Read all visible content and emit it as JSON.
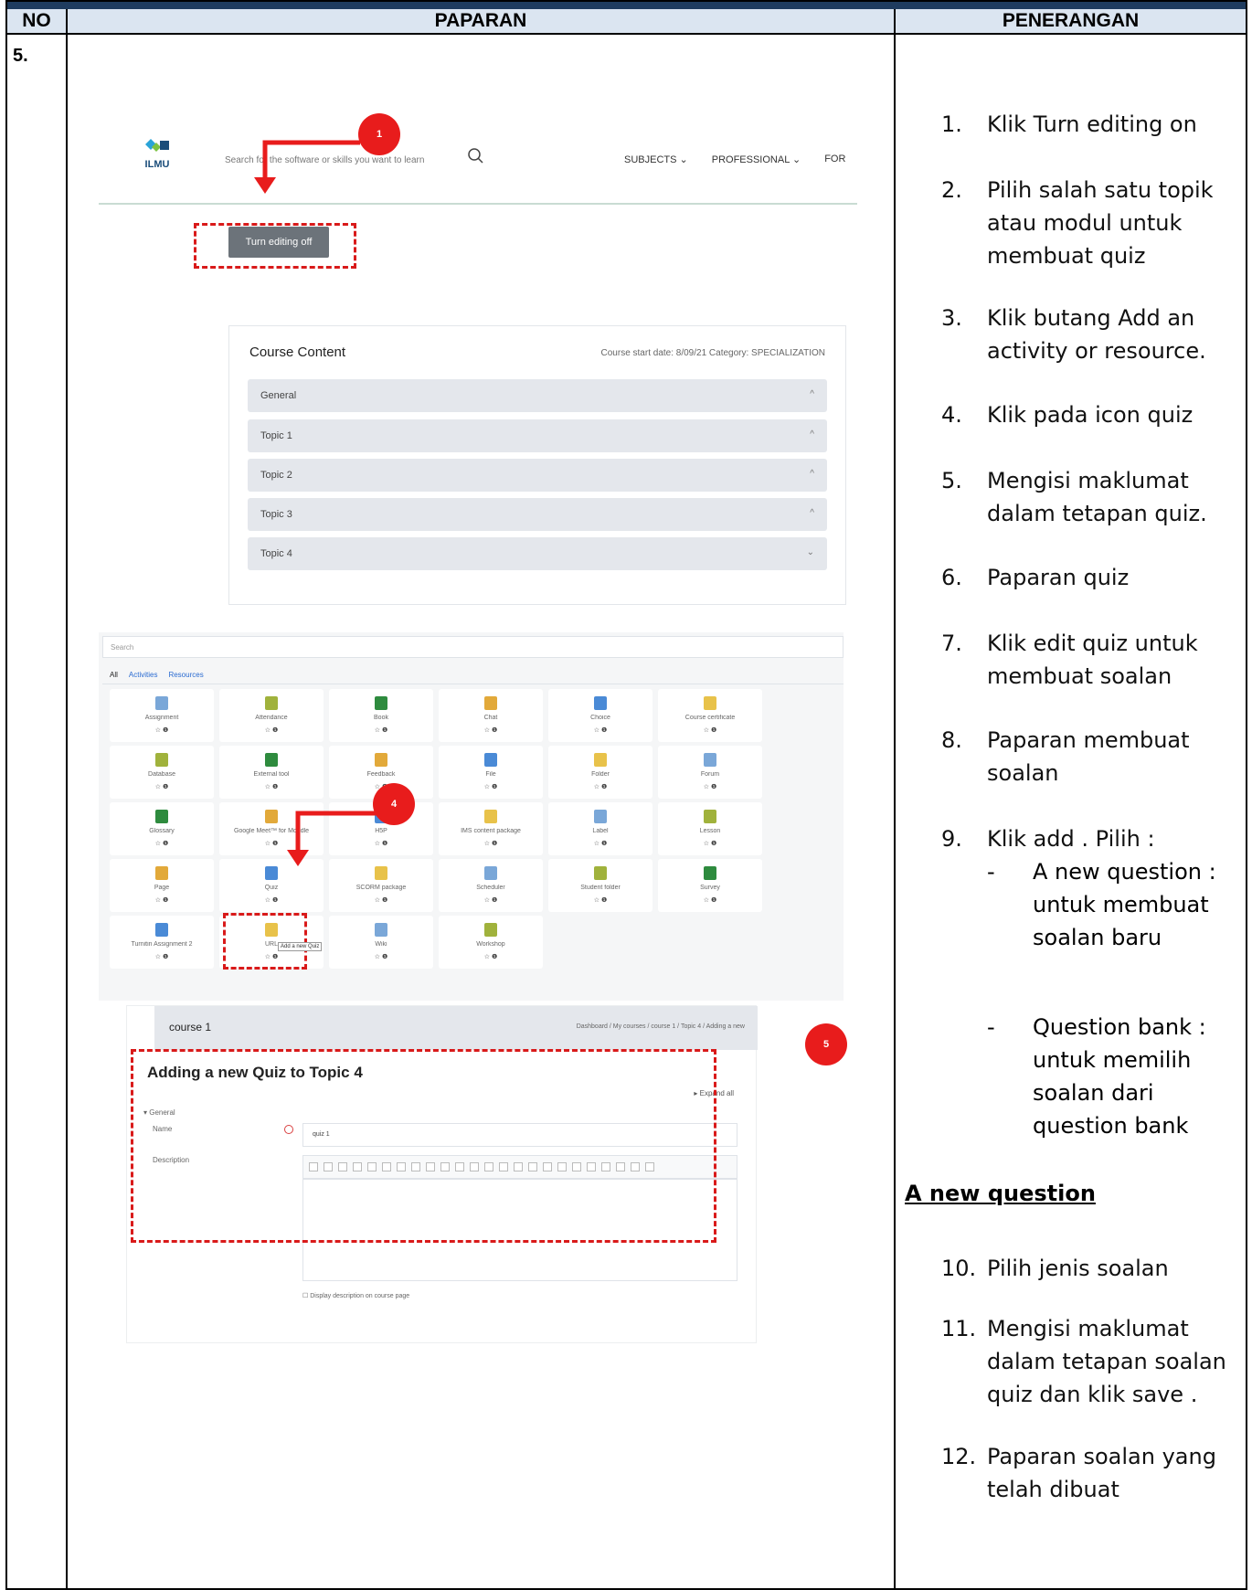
{
  "header": {
    "col_no": "NO",
    "col_display": "PAPARAN",
    "col_desc": "PENERANGAN"
  },
  "row": {
    "number": "5."
  },
  "steps": [
    {
      "n": "1.",
      "text": "Klik Turn editing on"
    },
    {
      "n": "2.",
      "text": "Pilih salah satu topik atau modul untuk membuat quiz"
    },
    {
      "n": "3.",
      "text": "Klik butang Add an activity or resource."
    },
    {
      "n": "4.",
      "text": "Klik pada icon quiz"
    },
    {
      "n": "5.",
      "text": "Mengisi maklumat dalam tetapan quiz."
    },
    {
      "n": "6.",
      "text": "Paparan quiz"
    },
    {
      "n": "7.",
      "text": "Klik edit quiz untuk membuat soalan"
    },
    {
      "n": "8.",
      "text": "Paparan membuat soalan"
    },
    {
      "n": "9.",
      "text": "Klik add . Pilih :"
    }
  ],
  "sub_steps": [
    {
      "d": "-",
      "text": "A new question : untuk membuat soalan baru"
    },
    {
      "d": "-",
      "text": "Question bank : untuk memilih soalan dari question bank"
    }
  ],
  "subheading": "A new question",
  "steps2": [
    {
      "n": "10.",
      "text": "Pilih jenis soalan"
    },
    {
      "n": "11.",
      "text": "Mengisi maklumat dalam tetapan soalan quiz dan klik save ."
    },
    {
      "n": "12.",
      "text": "Paparan soalan yang telah dibuat"
    }
  ],
  "shot1": {
    "logo_text": "ILMU",
    "search_placeholder": "Search for the software or skills you want to learn",
    "nav": [
      "SUBJECTS ⌄",
      "PROFESSIONAL ⌄",
      "FOR"
    ],
    "edit_button": "Turn editing off",
    "card_title": "Course Content",
    "card_meta": "Course start date: 8/09/21   Category: SPECIALIZATION",
    "topics": [
      "General",
      "Topic 1",
      "Topic 2",
      "Topic 3",
      "Topic 4"
    ],
    "marker": "1"
  },
  "shot2": {
    "search": "Search",
    "tabs": [
      "All",
      "Activities",
      "Resources"
    ],
    "tiles": [
      [
        "Assignment",
        "Attendance",
        "Book",
        "Chat",
        "Choice",
        "Course certificate"
      ],
      [
        "Database",
        "External tool",
        "Feedback",
        "File",
        "Folder",
        "Forum"
      ],
      [
        "Glossary",
        "Google Meet™ for Moodle",
        "H5P",
        "IMS content package",
        "Label",
        "Lesson"
      ],
      [
        "Page",
        "Quiz",
        "SCORM package",
        "Scheduler",
        "Student folder",
        "Survey"
      ],
      [
        "Turnitin Assignment 2",
        "URL",
        "Wiki",
        "Workshop"
      ]
    ],
    "tile_status": "☆  ❶",
    "tooltip": "Add a new Quiz",
    "marker": "4",
    "tile_colors": [
      "#7aa7d8",
      "#a0b23c",
      "#2e8b3e",
      "#e2a93a",
      "#4a8ad6",
      "#e8c24a"
    ]
  },
  "shot3": {
    "course": "course 1",
    "breadcrumb": "Dashboard  /  My courses  /  course 1  /  Topic 4  /  Adding a new",
    "title": "Adding a new Quiz to Topic 4",
    "expand": "▸ Expand all",
    "general": "▾  General",
    "name_label": "Name",
    "name_value": "quiz 1",
    "desc_label": "Description",
    "display_check": "☐  Display description on course page",
    "marker": "5"
  },
  "colors": {
    "accent_red": "#e81c1c",
    "header_bg": "#dbe5f1",
    "top_bar": "#1f3c5f"
  }
}
